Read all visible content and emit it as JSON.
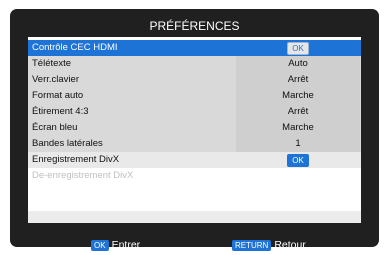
{
  "title": "PRÉFÉRENCES",
  "menu": {
    "items": [
      {
        "label": "Contrôle CEC HDMI",
        "value": "OK",
        "value_type": "button",
        "state": "selected"
      },
      {
        "label": "Télétexte",
        "value": "Auto",
        "value_type": "text",
        "state": "normal"
      },
      {
        "label": "Verr.clavier",
        "value": "Arrêt",
        "value_type": "text",
        "state": "normal"
      },
      {
        "label": "Format auto",
        "value": "Marche",
        "value_type": "text",
        "state": "normal"
      },
      {
        "label": "Étirement 4:3",
        "value": "Arrêt",
        "value_type": "text",
        "state": "normal"
      },
      {
        "label": "Écran bleu",
        "value": "Marche",
        "value_type": "text",
        "state": "normal"
      },
      {
        "label": "Bandes latérales",
        "value": "1",
        "value_type": "text",
        "state": "normal"
      },
      {
        "label": "Enregistrement DivX",
        "value": "OK",
        "value_type": "button",
        "state": "normal"
      },
      {
        "label": "De-enregistrement DivX",
        "value": "",
        "value_type": "none",
        "state": "disabled"
      }
    ]
  },
  "footer": {
    "enter_key": "OK",
    "enter_label": "Entrer",
    "return_key": "RETURN",
    "return_label": "Retour"
  },
  "colors": {
    "accent": "#1e73d6",
    "frame": "#202020",
    "row_bg": "#d9d9d9"
  }
}
